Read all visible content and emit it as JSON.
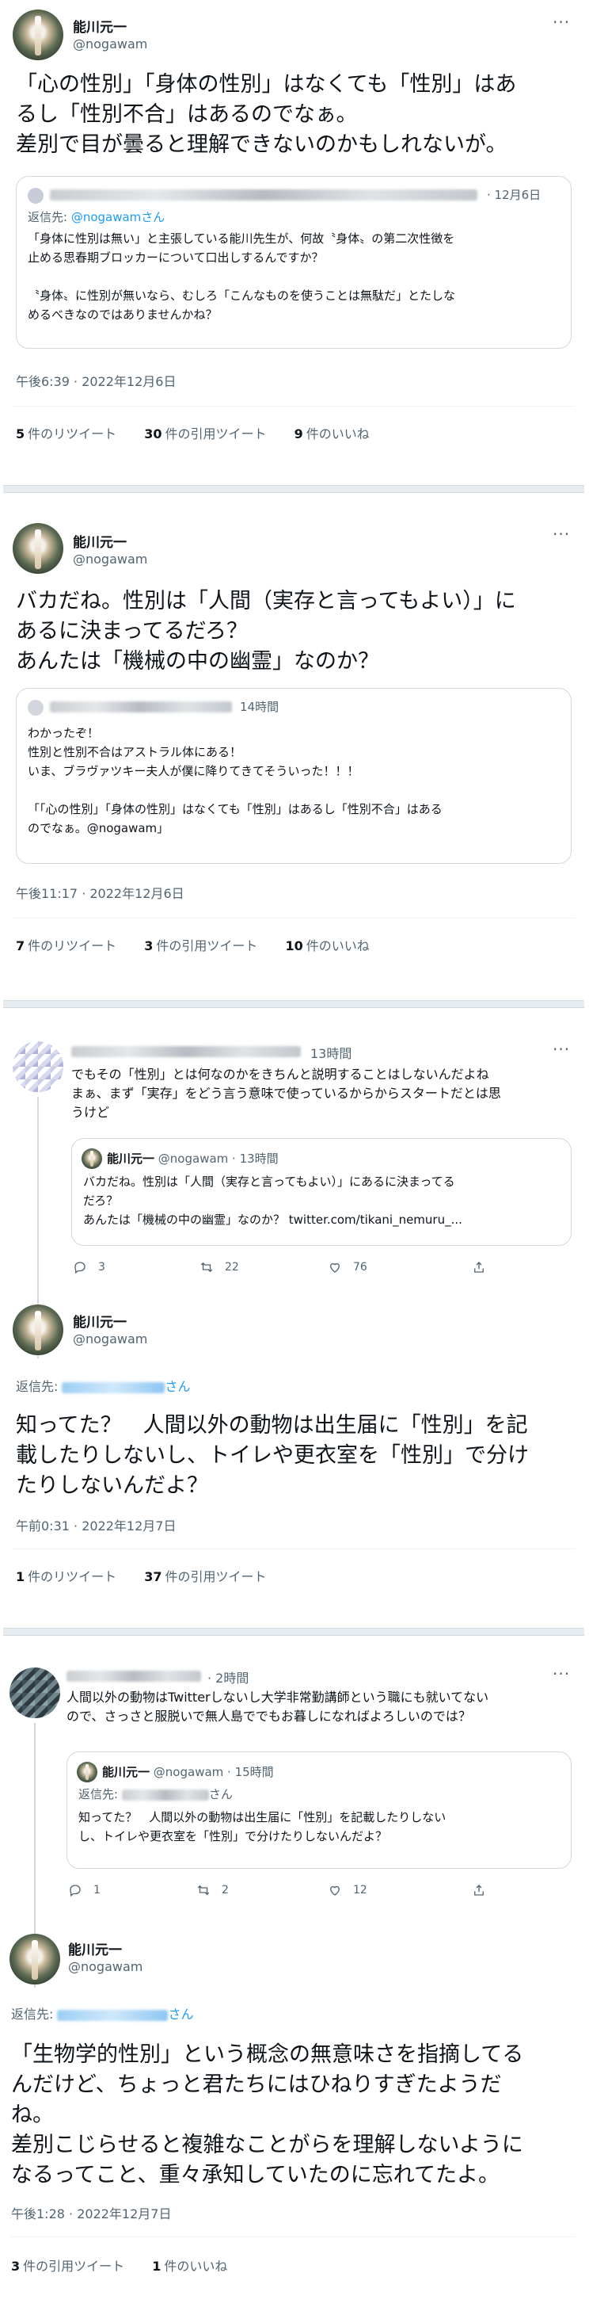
{
  "tweet1": {
    "name": "能川元一",
    "handle": "@nogawam",
    "text": [
      "「心の性別」「身体の性別」はなくても「性別」はあ",
      "るし「性別不合」はあるのでなぁ。",
      "差別で目が曇ると理解できないのかもしれないが。"
    ],
    "quote": {
      "date": "· 12月6日",
      "reply_to_label": "返信先: ",
      "reply_to_handle": "@nogawamさん",
      "lines": [
        "「身体に性別は無い」と主張している能川先生が、何故〝身体〟の第二次性徴を",
        "止める思春期ブロッカーについて口出しするんですか？",
        "",
        "〝身体〟に性別が無いなら、むしろ「こんなものを使うことは無駄だ」とたしな",
        "めるべきなのではありませんかね？"
      ]
    },
    "timestamp": "午後6:39 · 2022年12月6日",
    "stats": [
      {
        "n": "5",
        "label": "件のリツイート"
      },
      {
        "n": "30",
        "label": "件の引用ツイート"
      },
      {
        "n": "9",
        "label": "件のいいね"
      }
    ]
  },
  "tweet2": {
    "name": "能川元一",
    "handle": "@nogawam",
    "text": [
      "バカだね。性別は「人間（実存と言ってもよい）」に",
      "あるに決まってるだろ？",
      "あんたは「機械の中の幽霊」なのか？"
    ],
    "quote": {
      "date": "14時間",
      "lines": [
        "わかったぞ！",
        "性別と性別不合はアストラル体にある！",
        "いま、ブラヴァツキー夫人が僕に降りてきてそういった！！！",
        "",
        "「「心の性別」「身体の性別」はなくても「性別」はあるし「性別不合」はある",
        "のでなぁ。@nogawam」"
      ]
    },
    "timestamp": "午後11:17 · 2022年12月6日",
    "stats": [
      {
        "n": "7",
        "label": "件のリツイート"
      },
      {
        "n": "3",
        "label": "件の引用ツイート"
      },
      {
        "n": "10",
        "label": "件のいいね"
      }
    ]
  },
  "tweet3": {
    "reply": {
      "date": "13時間",
      "lines": [
        "でもその「性別」とは何なのかをきちんと説明することはしないんだよね",
        "まぁ、まず「実存」をどう言う意味で使っているからからスタートだとは思",
        "うけど"
      ],
      "quote": {
        "name": "能川元一",
        "handle_date": "@nogawam · 13時間",
        "lines": [
          "バカだね。性別は「人間（実存と言ってもよい）」にあるに決まってる",
          "だろ？",
          "あんたは「機械の中の幽霊」なのか？ twitter.com/tikani_nemuru_..."
        ]
      },
      "actions": {
        "reply": "3",
        "retweet": "22",
        "like": "76"
      }
    },
    "main": {
      "name": "能川元一",
      "handle": "@nogawam",
      "reply_to_label": "返信先: ",
      "reply_to_suffix": "さん",
      "text": [
        "知ってた？　人間以外の動物は出生届に「性別」を記",
        "載したりしないし、トイレや更衣室を「性別」で分け",
        "たりしないんだよ？"
      ],
      "timestamp": "午前0:31 · 2022年12月7日",
      "stats": [
        {
          "n": "1",
          "label": "件のリツイート"
        },
        {
          "n": "37",
          "label": "件の引用ツイート"
        }
      ]
    }
  },
  "tweet4": {
    "reply": {
      "date": "· 2時間",
      "lines": [
        "人間以外の動物はTwitterしないし大学非常勤講師という職にも就いてない",
        "ので、さっさと服脱いで無人島ででもお暮しになればよろしいのでは？"
      ],
      "quote": {
        "name": "能川元一",
        "handle_date": "@nogawam · 15時間",
        "reply_to_label": "返信先: ",
        "reply_to_suffix": "さん",
        "lines": [
          "知ってた？　人間以外の動物は出生届に「性別」を記載したりしない",
          "し、トイレや更衣室を「性別」で分けたりしないんだよ？"
        ]
      },
      "actions": {
        "reply": "1",
        "retweet": "2",
        "like": "12"
      }
    },
    "main": {
      "name": "能川元一",
      "handle": "@nogawam",
      "reply_to_label": "返信先: ",
      "reply_to_suffix": "さん",
      "text": [
        "「生物学的性別」という概念の無意味さを指摘してる",
        "んだけど、ちょっと君たちにはひねりすぎたようだ",
        "ね。",
        "差別こじらせると複雑なことがらを理解しないように",
        "なるってこと、重々承知していたのに忘れてたよ。"
      ],
      "timestamp": "午後1:28 · 2022年12月7日",
      "stats": [
        {
          "n": "3",
          "label": "件の引用ツイート"
        },
        {
          "n": "1",
          "label": "件のいいね"
        }
      ]
    }
  },
  "more_label": "···"
}
